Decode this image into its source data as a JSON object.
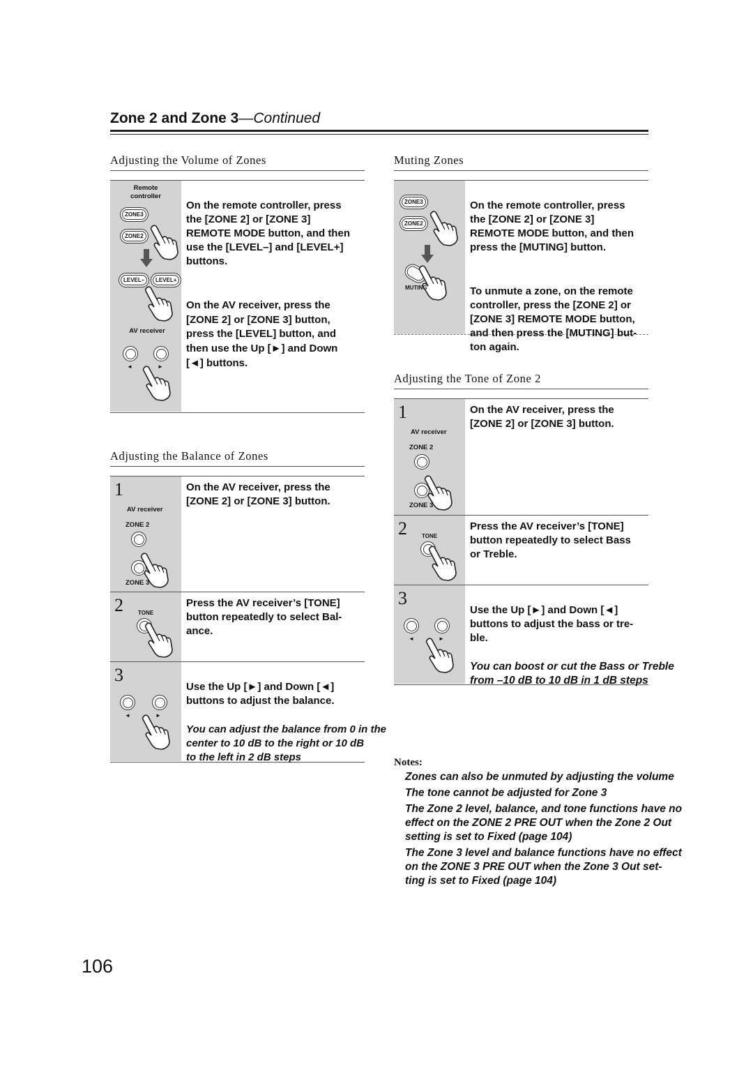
{
  "header": {
    "title": "Zone 2 and Zone 3",
    "continued": "—Continued"
  },
  "volume": {
    "heading": "Adjusting the Volume of Zones",
    "labels": {
      "remote": "Remote\ncontroller",
      "zone3": "ZONE3",
      "zone2": "ZONE2",
      "level_minus": "LEVEL–",
      "level_plus": "LEVEL+",
      "av": "AV receiver"
    },
    "p1": "On the remote controller, press\nthe [ZONE 2] or [ZONE 3]\nREMOTE MODE button, and then\nuse the [LEVEL–] and [LEVEL+]\nbuttons.",
    "p2": "On the AV receiver, press the\n[ZONE 2] or [ZONE 3] button,\npress the [LEVEL] button, and\nthen use the Up [►] and Down\n[◄] buttons."
  },
  "balance": {
    "heading": "Adjusting the Balance of Zones",
    "steps": [
      {
        "num": "1",
        "labels": {
          "av": "AV receiver",
          "zone2": "ZONE 2",
          "zone3": "ZONE 3"
        },
        "text": "On the AV receiver, press the\n[ZONE 2] or [ZONE 3] button."
      },
      {
        "num": "2",
        "labels": {
          "tone": "TONE"
        },
        "text": "Press the AV receiver’s [TONE]\nbutton repeatedly to select Bal-\nance."
      },
      {
        "num": "3",
        "text": "Use the Up [►] and Down [◄]\nbuttons to adjust the balance.",
        "note": "You can adjust the balance from 0 in the\ncenter to   10 dB to the right or   10 dB\nto the left in 2 dB steps"
      }
    ]
  },
  "muting": {
    "heading": "Muting Zones",
    "labels": {
      "zone3": "ZONE3",
      "zone2": "ZONE2",
      "muting": "MUTING"
    },
    "p1": "On the remote controller, press\nthe [ZONE 2] or [ZONE 3]\nREMOTE MODE button, and then\npress the [MUTING] button.",
    "p2": "To unmute a zone, on the remote\ncontroller, press the [ZONE 2] or\n[ZONE 3] REMOTE MODE button,\nand then press the [MUTING] but-\nton again."
  },
  "tone": {
    "heading": "Adjusting the Tone of Zone 2",
    "steps": [
      {
        "num": "1",
        "labels": {
          "av": "AV receiver",
          "zone2": "ZONE 2",
          "zone3": "ZONE 3"
        },
        "text": "On the AV receiver, press the\n[ZONE 2] or [ZONE 3] button."
      },
      {
        "num": "2",
        "labels": {
          "tone": "TONE"
        },
        "text": "Press the AV receiver’s [TONE]\nbutton repeatedly to select Bass\nor Treble."
      },
      {
        "num": "3",
        "text": "Use the Up [►] and Down [◄]\nbuttons to adjust the bass or tre-\nble.",
        "note": "You can boost or cut the Bass or Treble\nfrom –10 dB to   10 dB in 1 dB steps"
      }
    ]
  },
  "notes": {
    "heading": "Notes:",
    "items": [
      "Zones can also be unmuted by adjusting the volume",
      "The tone cannot be adjusted for Zone 3",
      "The Zone 2 level, balance, and tone functions have no\neffect on the ZONE 2 PRE OUT when the Zone 2 Out\nsetting is set to Fixed (page 104)",
      "The Zone 3 level and balance functions have no effect\non the ZONE 3 PRE OUT when the Zone 3 Out set-\nting is set to Fixed (page 104)"
    ]
  },
  "page_number": "106",
  "arrows": {
    "left": "◄",
    "right": "►"
  }
}
